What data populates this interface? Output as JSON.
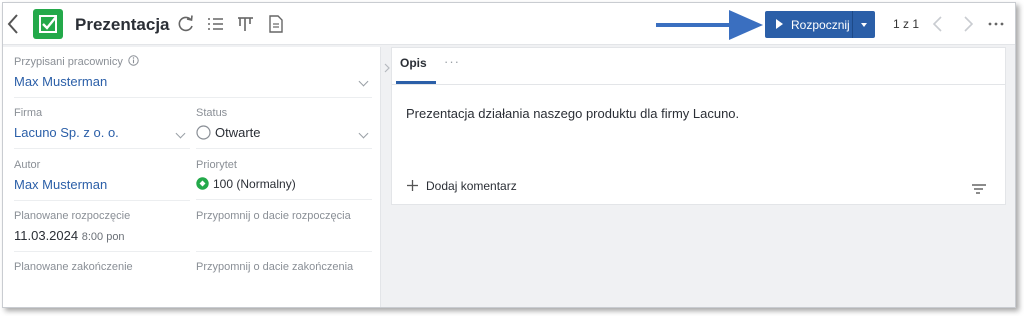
{
  "header": {
    "title": "Prezentacja",
    "start_button": "Rozpocznij",
    "pager": "1 z 1"
  },
  "fields": {
    "assigned_label": "Przypisani pracownicy",
    "assigned_value": "Max Musterman",
    "company_label": "Firma",
    "company_value": "Lacuno Sp. z o. o.",
    "status_label": "Status",
    "status_value": "Otwarte",
    "author_label": "Autor",
    "author_value": "Max Musterman",
    "priority_label": "Priorytet",
    "priority_value": "100 (Normalny)",
    "planned_start_label": "Planowane rozpoczęcie",
    "planned_start_date": "11.03.2024",
    "planned_start_time": "8:00 pon",
    "remind_start_label": "Przypomnij o dacie rozpoczęcia",
    "planned_end_label": "Planowane zakończenie",
    "remind_end_label": "Przypomnij o dacie zakończenia"
  },
  "detail": {
    "tab_label": "Opis",
    "tab_more": "···",
    "description": "Prezentacja działania naszego produktu dla firmy Lacuno.",
    "add_comment": "Dodaj komentarz"
  },
  "colors": {
    "accent": "#2b5fa8",
    "app_icon": "#23a94a",
    "priority": "#23a94a",
    "annotation_arrow": "#3a6fc0"
  }
}
